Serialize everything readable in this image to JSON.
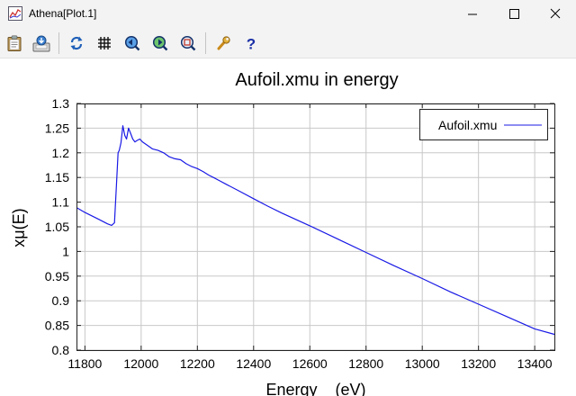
{
  "window": {
    "title": "Athena[Plot.1]"
  },
  "toolbar": {
    "buttons": [
      {
        "icon": "clipboard-icon"
      },
      {
        "icon": "save-export-icon"
      },
      {
        "icon": "refresh-icon"
      },
      {
        "icon": "grid-icon"
      },
      {
        "icon": "zoom-back-icon"
      },
      {
        "icon": "zoom-forward-icon"
      },
      {
        "icon": "zoom-icon"
      },
      {
        "icon": "wrench-icon"
      },
      {
        "icon": "help-icon"
      }
    ]
  },
  "colors": {
    "series": "#1a1ae6",
    "grid": "#c8c8c8",
    "titlebar": "#f3f3f3"
  },
  "chart_data": {
    "type": "line",
    "title": "Aufoil.xmu in energy",
    "xlabel": "Energy    (eV)",
    "ylabel": "xμ(E)",
    "xlim": [
      11770,
      13470
    ],
    "ylim": [
      0.8,
      1.3
    ],
    "xticks": [
      11800,
      12000,
      12200,
      12400,
      12600,
      12800,
      13000,
      13200,
      13400
    ],
    "yticks": [
      "0.8",
      "0.85",
      "0.9",
      "0.95",
      "1",
      "1.05",
      "1.1",
      "1.15",
      "1.2",
      "1.25",
      "1.3"
    ],
    "grid": true,
    "legend_position": "top-right",
    "series": [
      {
        "name": "Aufoil.xmu",
        "x": [
          11770,
          11800,
          11850,
          11880,
          11895,
          11905,
          11912,
          11918,
          11922,
          11928,
          11935,
          11942,
          11948,
          11955,
          11962,
          11970,
          11978,
          11985,
          11995,
          12005,
          12020,
          12040,
          12060,
          12080,
          12100,
          12120,
          12140,
          12160,
          12180,
          12200,
          12220,
          12240,
          12260,
          12280,
          12300,
          12350,
          12400,
          12450,
          12500,
          12600,
          12700,
          12800,
          12900,
          13000,
          13100,
          13200,
          13300,
          13400,
          13470
        ],
        "y": [
          1.089,
          1.079,
          1.065,
          1.056,
          1.053,
          1.058,
          1.135,
          1.2,
          1.205,
          1.22,
          1.255,
          1.235,
          1.228,
          1.25,
          1.24,
          1.228,
          1.222,
          1.225,
          1.228,
          1.222,
          1.216,
          1.208,
          1.205,
          1.2,
          1.192,
          1.188,
          1.186,
          1.178,
          1.172,
          1.168,
          1.162,
          1.155,
          1.149,
          1.143,
          1.137,
          1.122,
          1.107,
          1.092,
          1.078,
          1.052,
          1.025,
          0.998,
          0.971,
          0.945,
          0.918,
          0.893,
          0.868,
          0.843,
          0.832
        ]
      }
    ]
  }
}
